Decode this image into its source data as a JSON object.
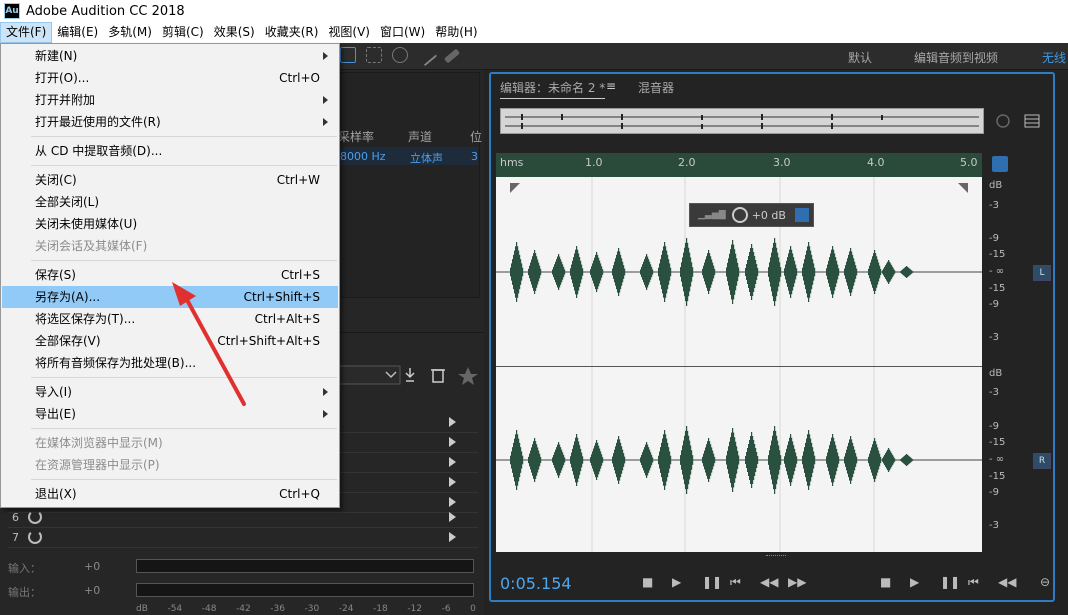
{
  "app": {
    "logo": "Au",
    "title": "Adobe Audition CC 2018"
  },
  "menubar": [
    "文件(F)",
    "编辑(E)",
    "多轨(M)",
    "剪辑(C)",
    "效果(S)",
    "收藏夹(R)",
    "视图(V)",
    "窗口(W)",
    "帮助(H)"
  ],
  "workspaces": {
    "default": "默认",
    "edit_to_video": "编辑音频到视频",
    "wireless": "无线"
  },
  "files_panel": {
    "columns": {
      "sample_rate": "采样率",
      "channels": "声道",
      "bit": "位"
    },
    "row": {
      "sample_rate": "8000 Hz",
      "channels": "立体声",
      "bit": "3"
    }
  },
  "file_menu": {
    "items": [
      {
        "label": "新建(N)",
        "submenu": true
      },
      {
        "label": "打开(O)...",
        "shortcut": "Ctrl+O"
      },
      {
        "label": "打开并附加",
        "submenu": true
      },
      {
        "label": "打开最近使用的文件(R)",
        "submenu": true
      },
      {
        "label": "从 CD 中提取音频(D)..."
      },
      {
        "label": "关闭(C)",
        "shortcut": "Ctrl+W"
      },
      {
        "label": "全部关闭(L)"
      },
      {
        "label": "关闭未使用媒体(U)"
      },
      {
        "label": "关闭会话及其媒体(F)",
        "disabled": true
      },
      {
        "label": "保存(S)",
        "shortcut": "Ctrl+S"
      },
      {
        "label": "另存为(A)...",
        "shortcut": "Ctrl+Shift+S",
        "highlighted": true
      },
      {
        "label": "将选区保存为(T)...",
        "shortcut": "Ctrl+Alt+S"
      },
      {
        "label": "全部保存(V)",
        "shortcut": "Ctrl+Shift+Alt+S"
      },
      {
        "label": "将所有音频保存为批处理(B)..."
      },
      {
        "label": "导入(I)",
        "submenu": true
      },
      {
        "label": "导出(E)",
        "submenu": true
      },
      {
        "label": "在媒体浏览器中显示(M)",
        "disabled": true
      },
      {
        "label": "在资源管理器中显示(P)",
        "disabled": true
      },
      {
        "label": "退出(X)",
        "shortcut": "Ctrl+Q"
      }
    ]
  },
  "effects_rack": {
    "row_numbers": [
      "6",
      "7"
    ]
  },
  "io": {
    "input_label": "输入：",
    "output_label": "输出：",
    "input_val": "+0",
    "output_val": "+0"
  },
  "db_scale_bottom": [
    "dB",
    "-54",
    "-48",
    "-42",
    "-36",
    "-30",
    "-24",
    "-18",
    "-12",
    "-6",
    "0"
  ],
  "editor": {
    "tab_editor": "编辑器：未命名 2 *",
    "tab_mixer": "混音器",
    "ruler": [
      "hms",
      "1.0",
      "2.0",
      "3.0",
      "4.0",
      "5.0"
    ],
    "hud_gain": "+0 dB",
    "db_labels_top": [
      "dB",
      "-3",
      "-9",
      "-15",
      "- ∞",
      "-15",
      "-9",
      "-3"
    ],
    "db_labels_bottom": [
      "dB",
      "-3",
      "-9",
      "-15",
      "- ∞",
      "-15",
      "-9",
      "-3"
    ],
    "channel_left": "L",
    "channel_right": "R",
    "time": "0:05.154"
  },
  "colors": {
    "accent": "#2d7cc6",
    "waveform": "#2a5040",
    "menu_highlight": "#91c9f7",
    "arrow": "#e03030"
  }
}
